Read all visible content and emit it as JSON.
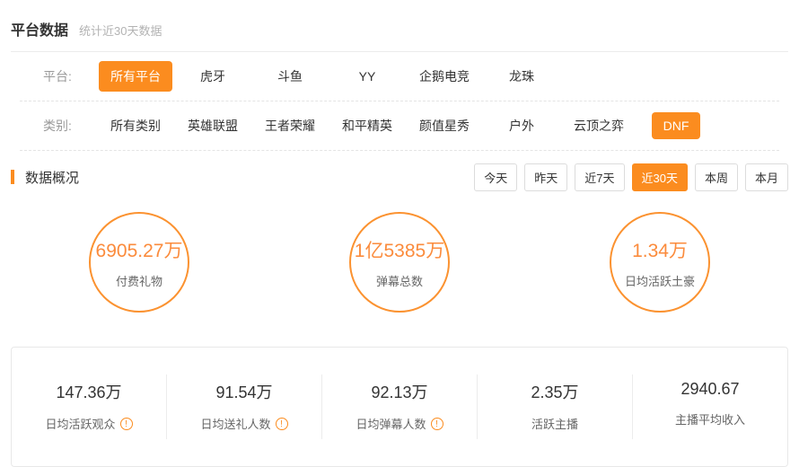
{
  "colors": {
    "accent": "#fb8c1f",
    "circle_value": "#fb8b3c",
    "circle_border": "#fb9230"
  },
  "icons": {
    "info_glyph": "!"
  },
  "header": {
    "title": "平台数据",
    "subtitle": "统计近30天数据"
  },
  "filters": [
    {
      "label": "平台:",
      "items": [
        {
          "label": "所有平台",
          "selected": true
        },
        {
          "label": "虎牙",
          "selected": false
        },
        {
          "label": "斗鱼",
          "selected": false
        },
        {
          "label": "YY",
          "selected": false
        },
        {
          "label": "企鹅电竞",
          "selected": false
        },
        {
          "label": "龙珠",
          "selected": false
        }
      ]
    },
    {
      "label": "类别:",
      "items": [
        {
          "label": "所有类别",
          "selected": false
        },
        {
          "label": "英雄联盟",
          "selected": false
        },
        {
          "label": "王者荣耀",
          "selected": false
        },
        {
          "label": "和平精英",
          "selected": false
        },
        {
          "label": "颜值星秀",
          "selected": false
        },
        {
          "label": "户外",
          "selected": false
        },
        {
          "label": "云顶之弈",
          "selected": false
        },
        {
          "label": "DNF",
          "selected": true
        }
      ]
    }
  ],
  "overview": {
    "title": "数据概况",
    "time_tabs": [
      {
        "label": "今天",
        "selected": false
      },
      {
        "label": "昨天",
        "selected": false
      },
      {
        "label": "近7天",
        "selected": false
      },
      {
        "label": "近30天",
        "selected": true
      },
      {
        "label": "本周",
        "selected": false
      },
      {
        "label": "本月",
        "selected": false
      }
    ],
    "circles": [
      {
        "value": "6905.27万",
        "label": "付费礼物"
      },
      {
        "value": "1亿5385万",
        "label": "弹幕总数"
      },
      {
        "value": "1.34万",
        "label": "日均活跃土豪"
      }
    ],
    "stats": [
      {
        "value": "147.36万",
        "label": "日均活跃观众",
        "info": true
      },
      {
        "value": "91.54万",
        "label": "日均送礼人数",
        "info": true
      },
      {
        "value": "92.13万",
        "label": "日均弹幕人数",
        "info": true
      },
      {
        "value": "2.35万",
        "label": "活跃主播",
        "info": false
      },
      {
        "value": "2940.67",
        "label": "主播平均收入",
        "info": false
      }
    ]
  }
}
